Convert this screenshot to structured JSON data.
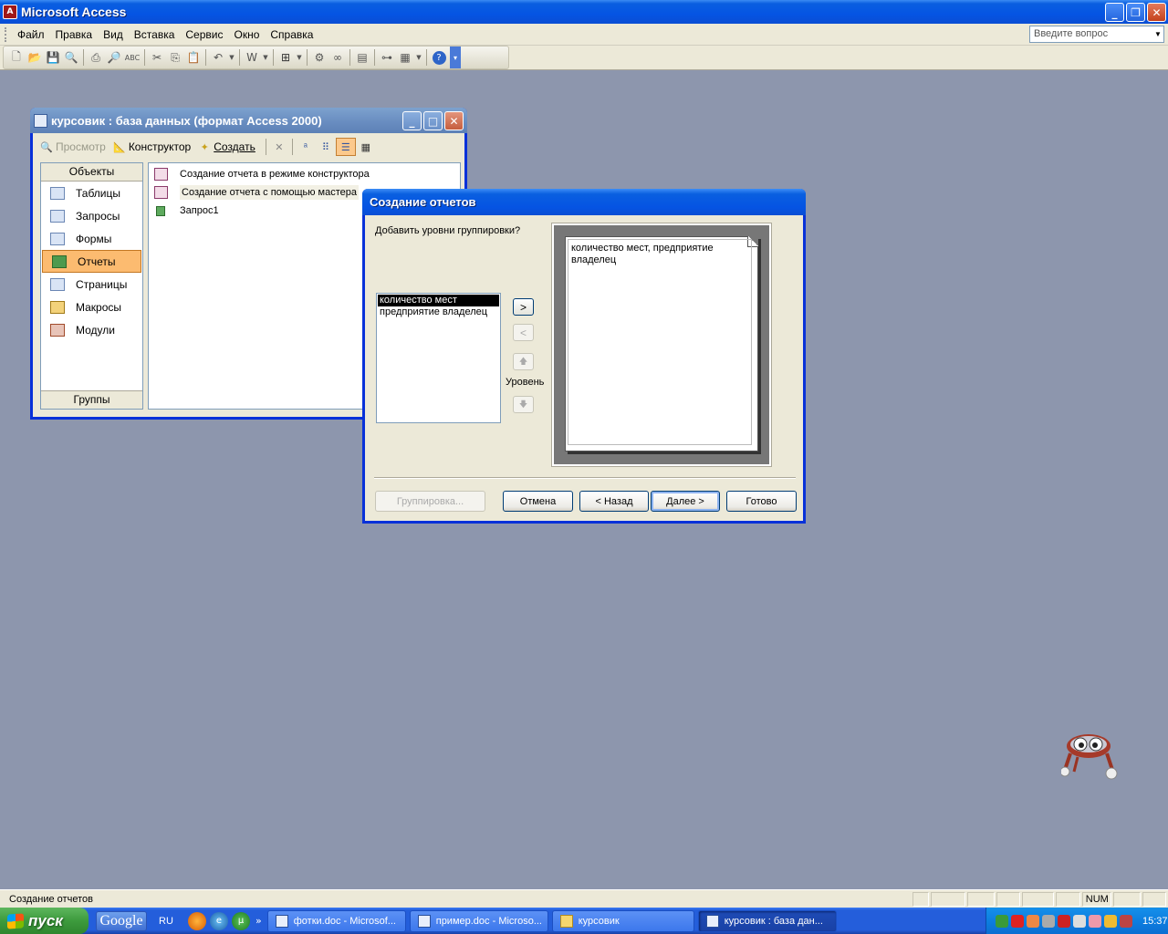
{
  "app": {
    "title": "Microsoft Access"
  },
  "menu": {
    "items": [
      "Файл",
      "Правка",
      "Вид",
      "Вставка",
      "Сервис",
      "Окно",
      "Справка"
    ],
    "ask_placeholder": "Введите вопрос"
  },
  "dbwindow": {
    "title": "курсовик : база данных (формат Access 2000)",
    "toolbar": {
      "open": "Просмотр",
      "design": "Конструктор",
      "new": "Создать"
    },
    "objects_header": "Объекты",
    "objects": [
      "Таблицы",
      "Запросы",
      "Формы",
      "Отчеты",
      "Страницы",
      "Макросы",
      "Модули"
    ],
    "selected_object": "Отчеты",
    "groups": "Группы",
    "list": [
      "Создание отчета в режиме конструктора",
      "Создание отчета с помощью мастера",
      "Запрос1"
    ]
  },
  "wizard": {
    "title": "Создание отчетов",
    "prompt": "Добавить уровни группировки?",
    "fields": [
      "количество мест",
      "предприятие владелец"
    ],
    "selected_field": "количество мест",
    "add_btn": ">",
    "remove_btn": "<",
    "up_icon": "🡅",
    "down_icon": "🡇",
    "level_label": "Уровень",
    "preview_text": "количество мест, предприятие владелец",
    "buttons": {
      "grouping": "Группировка...",
      "cancel": "Отмена",
      "back": "< Назад",
      "next": "Далее >",
      "finish": "Готово"
    }
  },
  "statusbar": {
    "text": "Создание отчетов",
    "num": "NUM"
  },
  "taskbar": {
    "start": "пуск",
    "google": "Google",
    "lang": "RU",
    "chevron": "»",
    "tasks": [
      "фотки.doc - Microsof...",
      "пример.doc - Microso...",
      "курсовик",
      "курсовик : база дан..."
    ],
    "clock": "15:37"
  }
}
